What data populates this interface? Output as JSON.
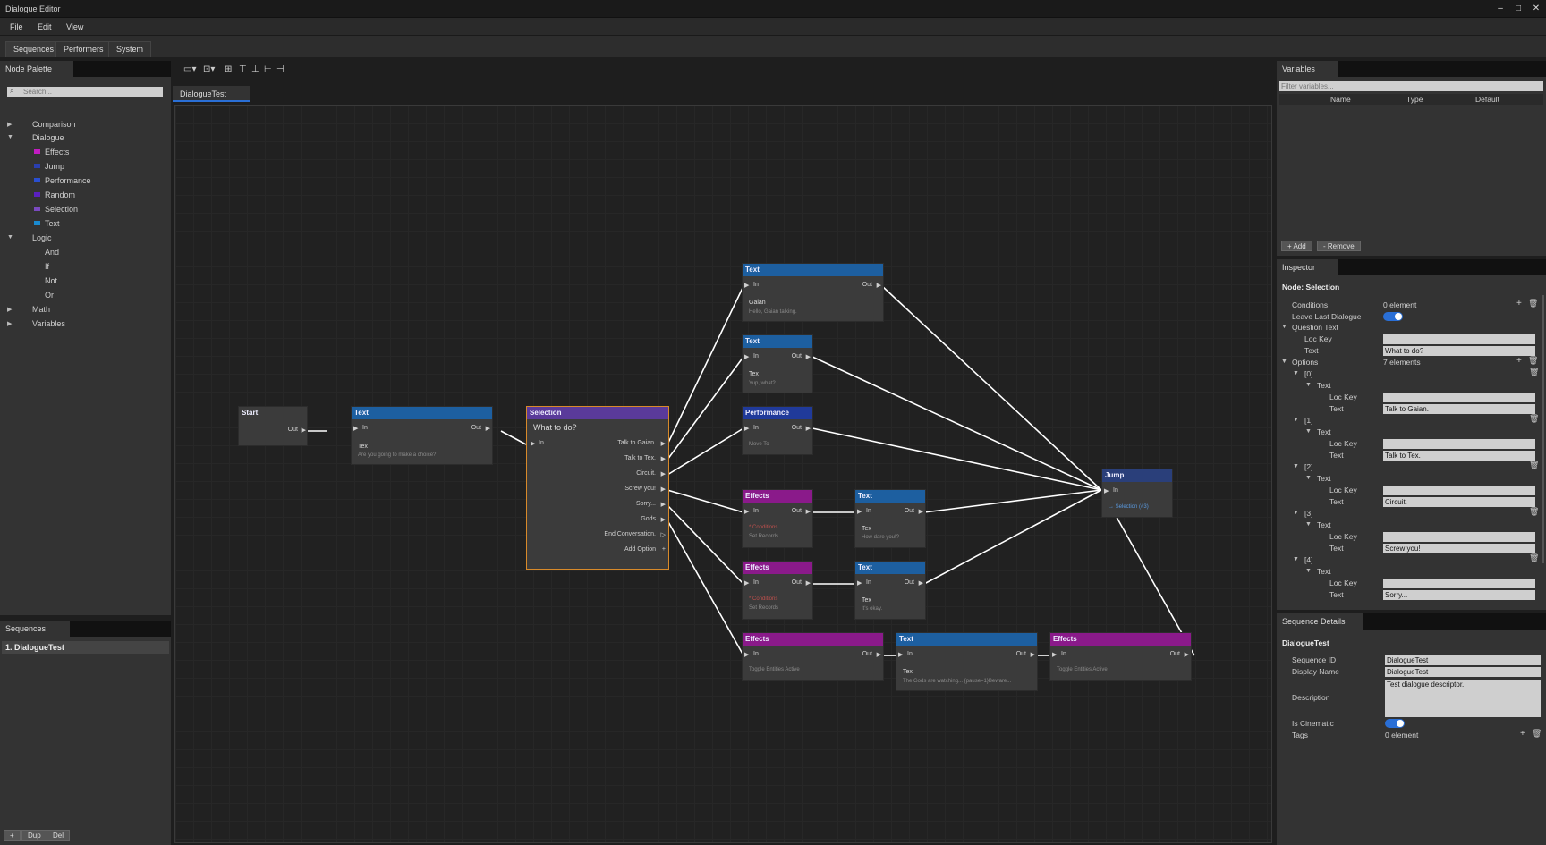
{
  "window": {
    "title": "Dialogue Editor"
  },
  "menu": {
    "file": "File",
    "edit": "Edit",
    "view": "View"
  },
  "main_tabs": {
    "sequences": "Sequences",
    "performers": "Performers",
    "system": "System"
  },
  "palette": {
    "title": "Node Palette",
    "search_placeholder": "Search...",
    "items": {
      "comparison": "Comparison",
      "dialogue": "Dialogue",
      "effects": "Effects",
      "jump": "Jump",
      "performance": "Performance",
      "random": "Random",
      "selection": "Selection",
      "text": "Text",
      "logic": "Logic",
      "and": "And",
      "if": "If",
      "not": "Not",
      "or": "Or",
      "math": "Math",
      "variables": "Variables"
    }
  },
  "sequences_panel": {
    "title": "Sequences",
    "item": "1. DialogueTest",
    "add": "+",
    "dup": "Dup",
    "del": "Del"
  },
  "graph_tab": "DialogueTest",
  "nodes": {
    "start": {
      "title": "Start",
      "out": "Out"
    },
    "text1": {
      "title": "Text",
      "in": "In",
      "out": "Out",
      "speaker": "Tex",
      "line": "Are you going to make a choice?"
    },
    "selection": {
      "title": "Selection",
      "question": "What to do?",
      "in": "In",
      "options": [
        "Talk to Gaian.",
        "Talk to Tex.",
        "Circuit.",
        "Screw you!",
        "Sorry...",
        "Gods",
        "End Conversation."
      ],
      "add_option": "Add Option"
    },
    "text_gaian": {
      "title": "Text",
      "in": "In",
      "out": "Out",
      "speaker": "Gaian",
      "line": "Hello, Gaian talking."
    },
    "text_tex": {
      "title": "Text",
      "in": "In",
      "out": "Out",
      "speaker": "Tex",
      "line": "Yup, what?"
    },
    "performance": {
      "title": "Performance",
      "in": "In",
      "out": "Out",
      "line": "Move To"
    },
    "effects1": {
      "title": "Effects",
      "in": "In",
      "out": "Out",
      "cond": "* Conditions",
      "line": "Set Records"
    },
    "text_howdare": {
      "title": "Text",
      "in": "In",
      "out": "Out",
      "speaker": "Tex",
      "line": "How dare you!?"
    },
    "effects2": {
      "title": "Effects",
      "in": "In",
      "out": "Out",
      "cond": "* Conditions",
      "line": "Set Records"
    },
    "text_okay": {
      "title": "Text",
      "in": "In",
      "out": "Out",
      "speaker": "Tex",
      "line": "It's okay."
    },
    "effects3": {
      "title": "Effects",
      "in": "In",
      "out": "Out",
      "line": "Toggle Entities Active"
    },
    "text_gods": {
      "title": "Text",
      "in": "In",
      "out": "Out",
      "speaker": "Tex",
      "line": "The Gods are watching... {pause=1}Beware..."
    },
    "effects4": {
      "title": "Effects",
      "in": "In",
      "out": "Out",
      "line": "Toggle Entities Active"
    },
    "jump": {
      "title": "Jump",
      "in": "In",
      "target": "→ Selection (#3)"
    }
  },
  "variables": {
    "title": "Variables",
    "filter_placeholder": "Filter variables...",
    "col_name": "Name",
    "col_type": "Type",
    "col_default": "Default",
    "add": "+ Add",
    "remove": "- Remove"
  },
  "inspector": {
    "title": "Inspector",
    "node_heading": "Node: Selection",
    "conditions": "Conditions",
    "conditions_val": "0 element",
    "leave_last": "Leave Last Dialogue",
    "question_text": "Question Text",
    "loc_key": "Loc Key",
    "text": "Text",
    "question_val": "What to do?",
    "options": "Options",
    "options_val": "7 elements",
    "opts": [
      {
        "idx": "[0]",
        "val": "Talk to Gaian."
      },
      {
        "idx": "[1]",
        "val": "Talk to Tex."
      },
      {
        "idx": "[2]",
        "val": "Circuit."
      },
      {
        "idx": "[3]",
        "val": "Screw you!"
      },
      {
        "idx": "[4]",
        "val": "Sorry..."
      }
    ]
  },
  "sequence_details": {
    "title": "Sequence Details",
    "heading": "DialogueTest",
    "seq_id_label": "Sequence ID",
    "seq_id": "DialogueTest",
    "display_name_label": "Display Name",
    "display_name": "DialogueTest",
    "description_label": "Description",
    "description": "Test dialogue descriptor.",
    "cinematic_label": "Is Cinematic",
    "tags_label": "Tags",
    "tags_val": "0 element"
  },
  "colors": {
    "text_header": "#1d5fa0",
    "selection_header": "#5a3a9a",
    "performance_header": "#203a9a",
    "effects_header": "#8a1a8a",
    "jump_header": "#2a3f7a",
    "accent_blue": "#2a6fd6"
  }
}
